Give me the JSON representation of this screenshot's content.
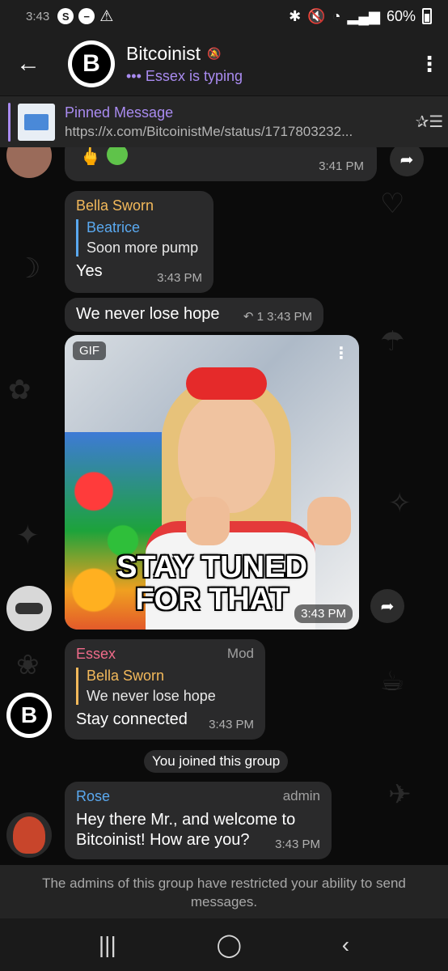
{
  "status_bar": {
    "time": "3:43",
    "battery": "60%"
  },
  "header": {
    "title": "Bitcoinist",
    "subtitle": "Essex is typing",
    "avatar_letter": "B"
  },
  "pinned": {
    "title": "Pinned Message",
    "url": "https://x.com/BitcoinistMe/status/1717803232..."
  },
  "messages": [
    {
      "time": "3:41 PM"
    },
    {
      "sender": "Bella Sworn",
      "sender_color": "#f3b95b",
      "quote_name": "Beatrice",
      "quote_text": "Soon more pump",
      "quote_color": "#5aa9f0",
      "text": "Yes",
      "time": "3:43 PM"
    },
    {
      "text": "We never lose hope",
      "reply_count": "1",
      "time": "3:43 PM"
    },
    {
      "gif_badge": "GIF",
      "gif_caption_line1": "STAY TUNED",
      "gif_caption_line2": "FOR THAT",
      "time": "3:43 PM"
    },
    {
      "sender": "Essex",
      "sender_color": "#f06b8a",
      "role": "Mod",
      "quote_name": "Bella Sworn",
      "quote_text": "We never lose hope",
      "quote_color": "#f3b95b",
      "text": "Stay connected",
      "time": "3:43 PM"
    },
    {
      "service": "You joined this group"
    },
    {
      "sender": "Rose",
      "sender_color": "#5aa9f0",
      "role": "admin",
      "text_line1": "Hey there Mr., and welcome to",
      "text_line2": "Bitcoinist! How are you?",
      "time": "3:43 PM"
    }
  ],
  "notice": "The admins of this group have restricted your ability to send messages."
}
